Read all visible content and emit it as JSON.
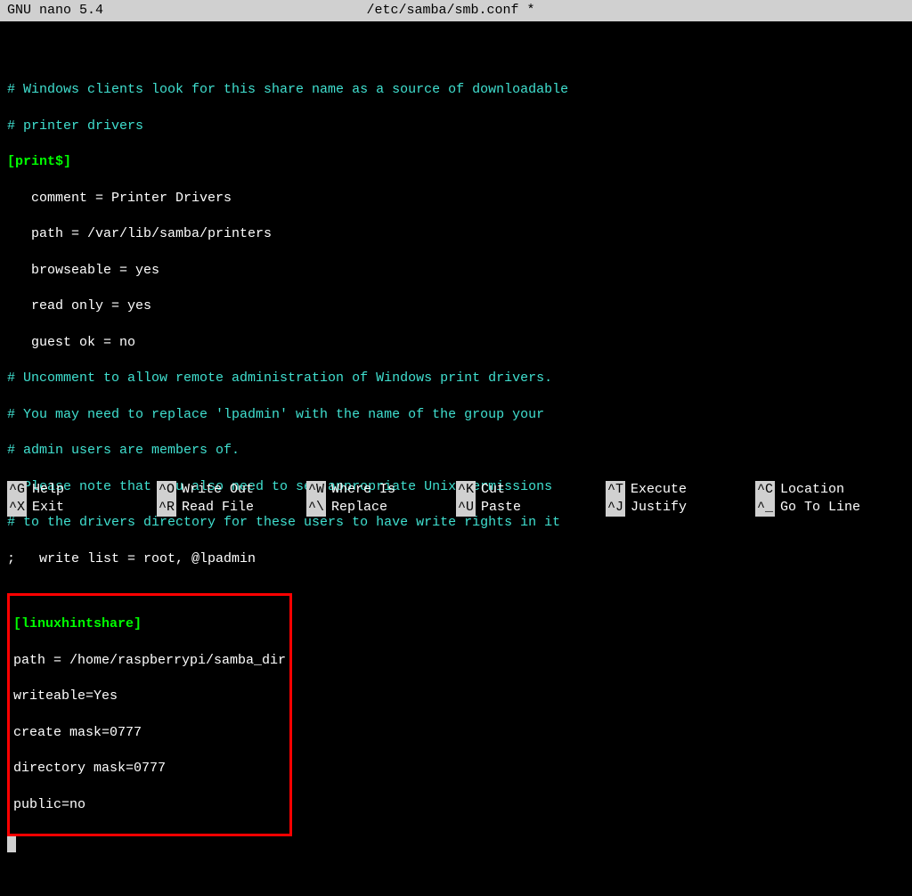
{
  "titlebar": {
    "app": "GNU nano 5.4",
    "filename": "/etc/samba/smb.conf *"
  },
  "content": {
    "comment1": "# Windows clients look for this share name as a source of downloadable",
    "comment2": "# printer drivers",
    "section_print": "[print$]",
    "print_comment": "   comment = Printer Drivers",
    "print_path": "   path = /var/lib/samba/printers",
    "print_browseable": "   browseable = yes",
    "print_readonly": "   read only = yes",
    "print_guest": "   guest ok = no",
    "comment3": "# Uncomment to allow remote administration of Windows print drivers.",
    "comment4": "# You may need to replace 'lpadmin' with the name of the group your",
    "comment5": "# admin users are members of.",
    "comment6": "# Please note that you also need to set appropriate Unix permissions",
    "comment7": "# to the drivers directory for these users to have write rights in it",
    "writelist": ";   write list = root, @lpadmin",
    "section_linuxhint": "[linuxhintshare]",
    "lh_path": "path = /home/raspberrypi/samba_dir",
    "lh_writeable": "writeable=Yes",
    "lh_create": "create mask=0777",
    "lh_directory": "directory mask=0777",
    "lh_public": "public=no"
  },
  "shortcuts": {
    "row1": [
      {
        "key": "^G",
        "label": "Help"
      },
      {
        "key": "^O",
        "label": "Write Out"
      },
      {
        "key": "^W",
        "label": "Where Is"
      },
      {
        "key": "^K",
        "label": "Cut"
      },
      {
        "key": "^T",
        "label": "Execute"
      },
      {
        "key": "^C",
        "label": "Location"
      }
    ],
    "row2": [
      {
        "key": "^X",
        "label": "Exit"
      },
      {
        "key": "^R",
        "label": "Read File"
      },
      {
        "key": "^\\",
        "label": "Replace"
      },
      {
        "key": "^U",
        "label": "Paste"
      },
      {
        "key": "^J",
        "label": "Justify"
      },
      {
        "key": "^_",
        "label": "Go To Line"
      }
    ]
  }
}
